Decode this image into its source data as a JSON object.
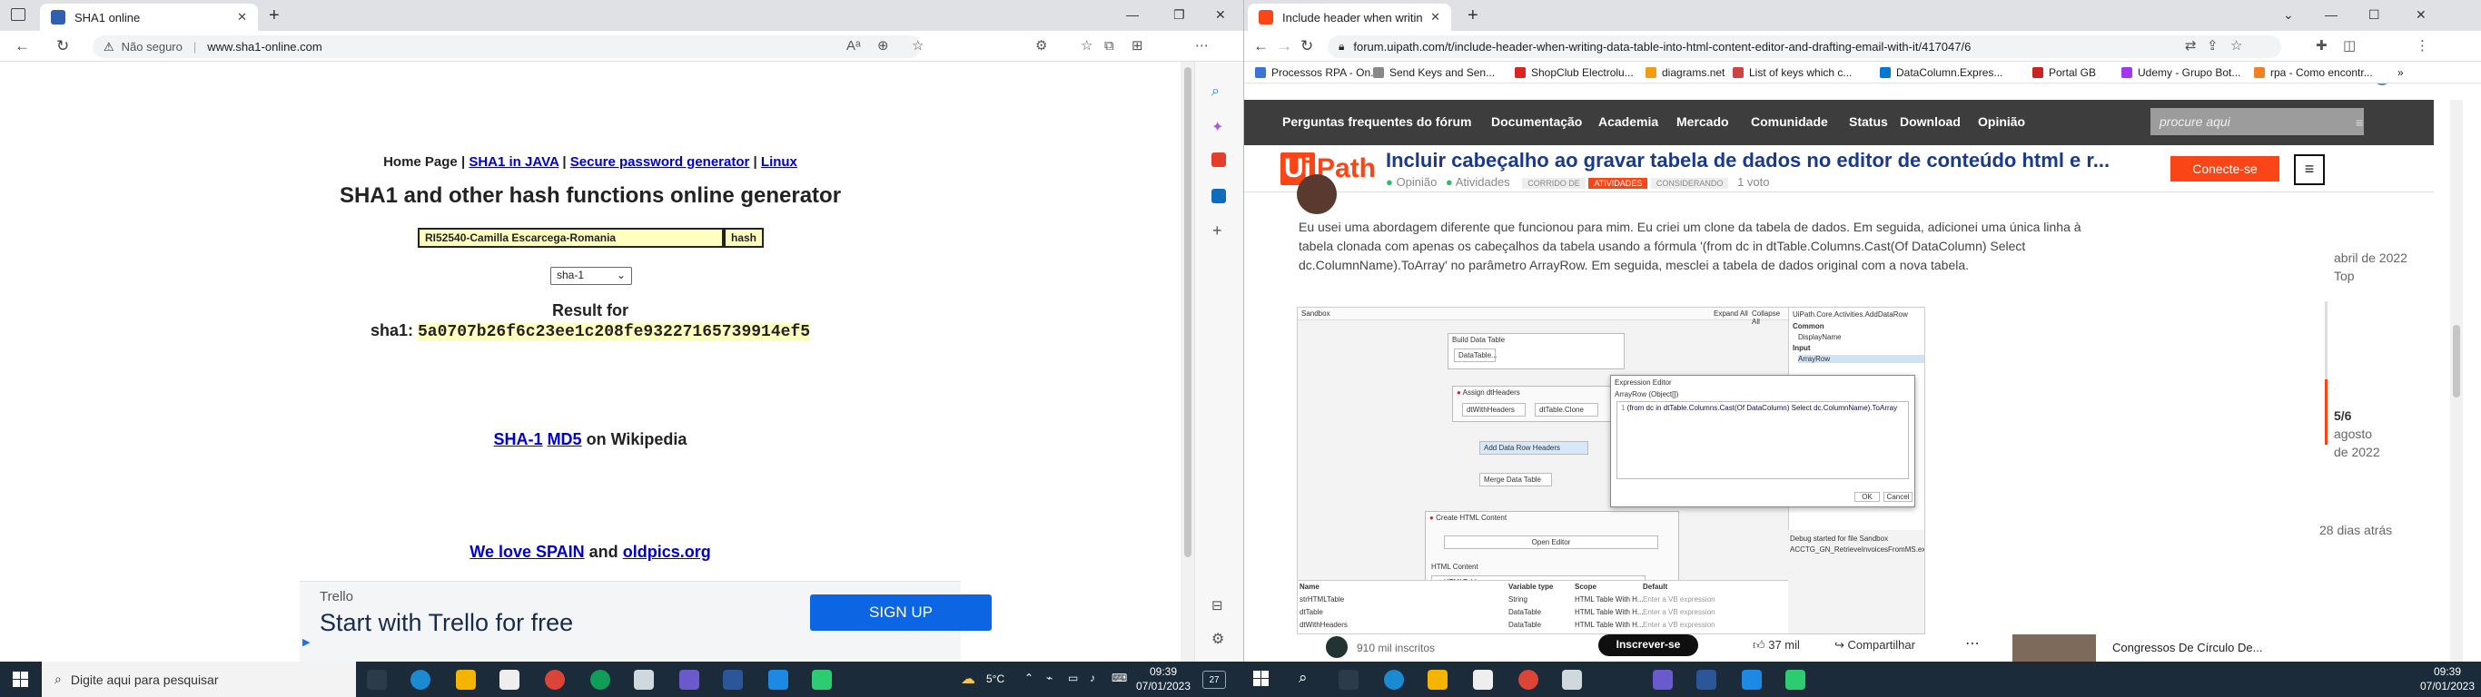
{
  "left_window": {
    "tab_title": "SHA1 online",
    "security_label": "Não seguro",
    "url": "www.sha1-online.com",
    "page": {
      "nav_links": {
        "home": "Home Page",
        "sep": "|",
        "java": "SHA1 in JAVA",
        "pwd": "Secure password generator",
        "linux": "Linux"
      },
      "heading": "SHA1 and other hash functions online generator",
      "input_value": "RI52540-Camilla Escarcega-Romania",
      "hash_button": "hash",
      "select_value": "sha-1",
      "result_label": "Result for",
      "result_prefix": "sha1:",
      "result_hash": "5a0707b26f6c23ee1c208fe93227165739914ef5",
      "wiki_sha1": "SHA-1",
      "wiki_md5": "MD5",
      "wiki_suffix": "on Wikipedia",
      "love_text": "We love SPAIN",
      "love_and": "and",
      "love_link": "oldpics.org",
      "ad": {
        "brand": "Trello",
        "headline": "Start with Trello for free",
        "cta": "SIGN UP"
      }
    }
  },
  "right_window": {
    "tab_title": "Include header when writing da",
    "url": "forum.uipath.com/t/include-header-when-writing-data-table-into-html-content-editor-and-drafting-email-with-it/417047/6",
    "bookmarks": [
      "Processos RPA - On...",
      "Send Keys and Sen...",
      "ShopClub Electrolu...",
      "diagrams.net",
      "List of keys which c...",
      "DataColumn.Expres...",
      "Portal GB",
      "Udemy - Grupo Bot...",
      "rpa - Como encontr..."
    ],
    "site": {
      "nav": [
        "Perguntas frequentes do fórum",
        "Documentação",
        "Academia",
        "Mercado",
        "Comunidade",
        "Status",
        "Download",
        "Opinião"
      ],
      "search_placeholder": "procure aqui",
      "logo_ui": "Ui",
      "logo_path": "Path",
      "topic_title": "Incluir cabeçalho ao gravar tabela de dados no editor de conteúdo html e r...",
      "meta": {
        "opiniao": "Opinião",
        "atividades": "Atividades",
        "tag1": "CORRIDO DE",
        "tag2": "ATIVIDADES",
        "tag3": "CONSIDERANDO",
        "votes": "1 voto"
      },
      "connect_button": "Conecte-se",
      "post_text": "Eu usei uma abordagem diferente que funcionou para mim. Eu criei um clone da tabela de dados. Em seguida, adicionei uma única linha à tabela clonada com apenas os cabeçalhos da tabela usando a fórmula '(from dc in dtTable.Columns.Cast(Of DataColumn) Select dc.ColumnName).ToArray' no parâmetro ArrayRow. Em seguida, mesclei a tabela de dados original com a nova tabela.",
      "timeline": {
        "date1": "abril de 2022",
        "top": "Top",
        "progress": "5/6",
        "date2a": "agosto",
        "date2b": "de 2022",
        "ago": "28 dias atrás"
      },
      "screenshot": {
        "sandbox": "Sandbox",
        "expand": "Expand All",
        "collapse": "Collapse All",
        "activity_path": "UiPath.Core.Activities.AddDataRow",
        "prop_common": "Common",
        "prop_display": "DisplayName",
        "prop_input": "Input",
        "prop_array": "ArrayRow",
        "build": "Build Data Table",
        "datatable": "DataTable...",
        "assign": "Assign dtHeaders",
        "assign_to": "dtWithHeaders",
        "assign_val": "dtTable.Clone",
        "add_row": "Add Data Row Headers",
        "merge": "Merge Data Table",
        "create_html": "Create HTML Content",
        "open_editor": "Open Editor",
        "html_content": "HTML Content",
        "html_var": "strHTMLTable",
        "expr_title": "Expression Editor",
        "expr_sub": "ArrayRow (Object[])",
        "expr_code": "(from dc in dtTable.Columns.Cast(Of DataColumn) Select dc.ColumnName).ToArray",
        "ok": "OK",
        "cancel": "Cancel",
        "debug": "Debug started for file Sandbox",
        "debug2": "ACCTG_GN_RetrieveInvoicesFromMS.exe",
        "var_headers": [
          "Name",
          "Variable type",
          "Scope",
          "Default"
        ],
        "var_rows": [
          [
            "strHTMLTable",
            "String",
            "HTML Table With H...",
            "Enter a VB expression"
          ],
          [
            "dtTable",
            "DataTable",
            "HTML Table With H...",
            "Enter a VB expression"
          ],
          [
            "dtWithHeaders",
            "DataTable",
            "HTML Table With H...",
            "Enter a VB expression"
          ]
        ]
      },
      "bottom_bar": {
        "subs": "910 mil inscritos",
        "subscribe": "Inscrever-se",
        "likes": "37 mil",
        "share": "Compartilhar",
        "video_title": "Congressos De Círculo De..."
      }
    }
  },
  "taskbar": {
    "search_placeholder": "Digite aqui para pesquisar",
    "weather": "5°C",
    "time_left": "09:39",
    "date_left": "07/01/2023",
    "notif_count": "27",
    "time_right": "09:39",
    "date_right": "07/01/2023"
  },
  "colors": {
    "uipath_orange": "#fa4616",
    "hash_bg": "#ffffc0",
    "link": "#0000cc",
    "nav_dark": "#3d3d3d",
    "taskbar": "#1c2b3a",
    "trello_btn": "#0c66e4"
  }
}
